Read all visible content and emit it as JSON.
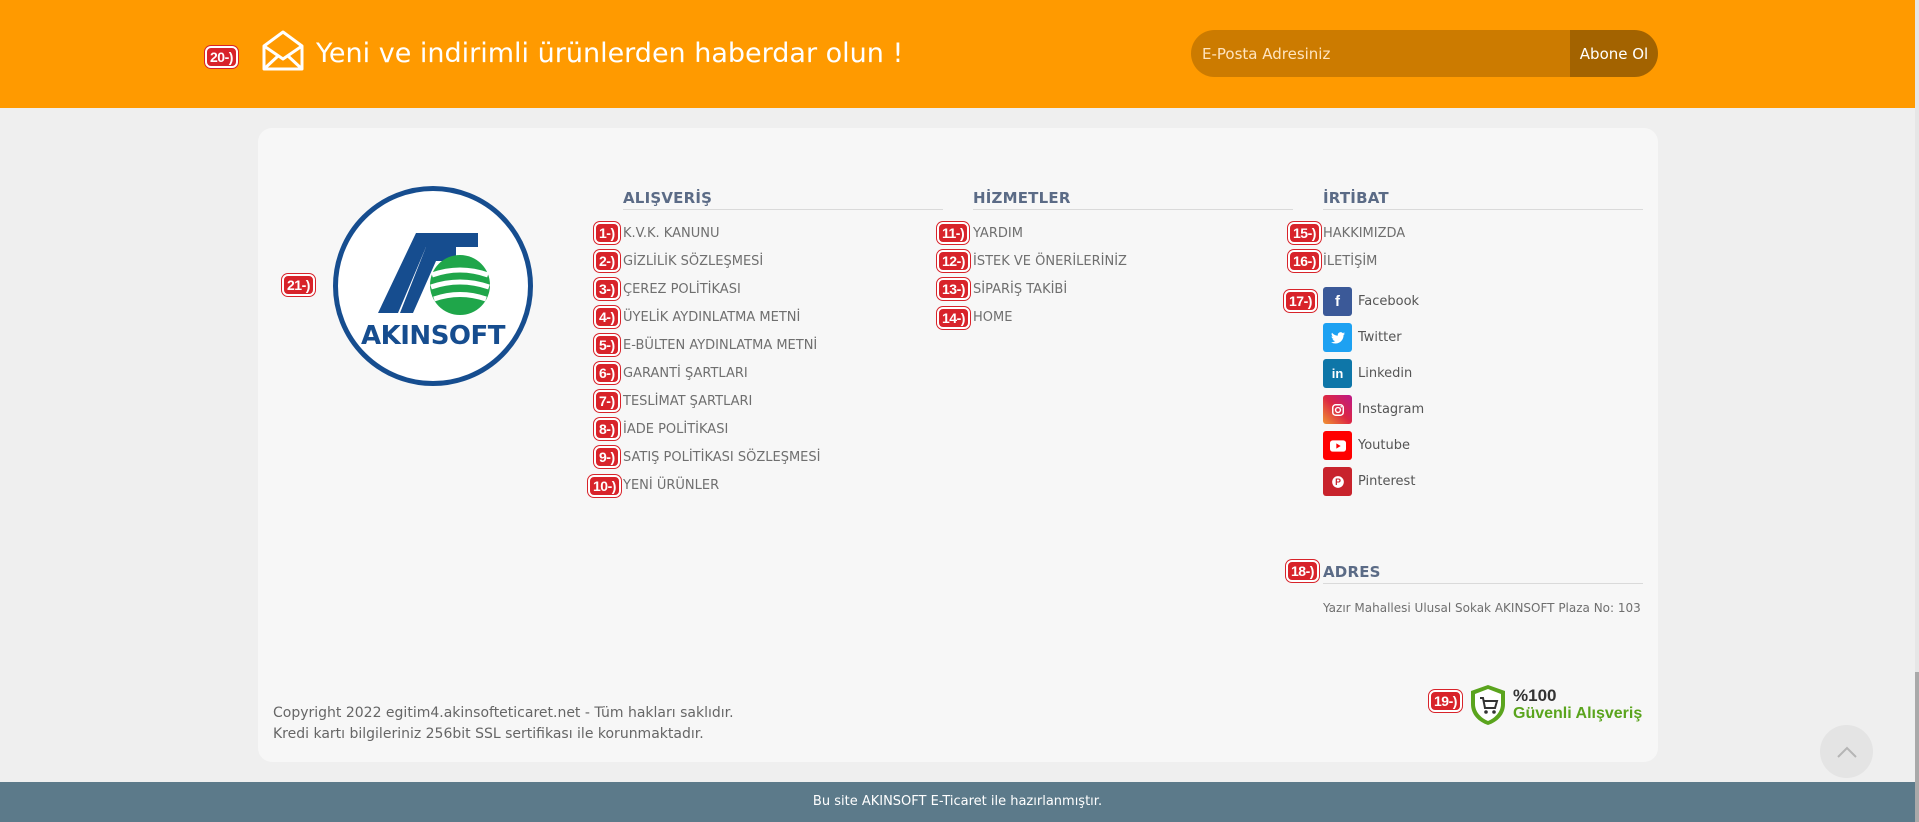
{
  "newsletter": {
    "badge": "20-)",
    "text": "Yeni ve indirimli ürünlerden haberdar olun !",
    "placeholder": "E-Posta Adresiniz",
    "button": "Abone Ol",
    "icon": "envelope-icon"
  },
  "logo": {
    "badge": "21-)",
    "word": "AKINSOFT"
  },
  "columns": {
    "alisveris": {
      "title": "ALIŞVERİŞ",
      "items": [
        {
          "badge": "1-)",
          "label": "K.V.K. KANUNU"
        },
        {
          "badge": "2-)",
          "label": "GİZLİLİK SÖZLEŞMESİ"
        },
        {
          "badge": "3-)",
          "label": "ÇEREZ POLİTİKASI"
        },
        {
          "badge": "4-)",
          "label": "ÜYELİK AYDINLATMA METNİ"
        },
        {
          "badge": "5-)",
          "label": "E-BÜLTEN AYDINLATMA METNİ"
        },
        {
          "badge": "6-)",
          "label": "GARANTİ ŞARTLARI"
        },
        {
          "badge": "7-)",
          "label": "TESLİMAT ŞARTLARI"
        },
        {
          "badge": "8-)",
          "label": "İADE POLİTİKASI"
        },
        {
          "badge": "9-)",
          "label": "SATIŞ POLİTİKASI SÖZLEŞMESİ"
        },
        {
          "badge": "10-)",
          "label": "YENİ ÜRÜNLER"
        }
      ]
    },
    "hizmetler": {
      "title": "HİZMETLER",
      "items": [
        {
          "badge": "11-)",
          "label": "YARDIM"
        },
        {
          "badge": "12-)",
          "label": "İSTEK VE ÖNERİLERİNİZ"
        },
        {
          "badge": "13-)",
          "label": "SİPARİŞ TAKİBİ"
        },
        {
          "badge": "14-)",
          "label": "HOME"
        }
      ]
    },
    "irtibat": {
      "title": "İRTİBAT",
      "items": [
        {
          "badge": "15-)",
          "label": "HAKKIMIZDA"
        },
        {
          "badge": "16-)",
          "label": "İLETİŞİM"
        }
      ],
      "social_badge": "17-)",
      "social": [
        {
          "label": "Facebook",
          "icon": "facebook-icon",
          "glyph": "f",
          "color": "#3b5998"
        },
        {
          "label": "Twitter",
          "icon": "twitter-icon",
          "glyph": "🐦",
          "color": "#1da1f2"
        },
        {
          "label": "Linkedin",
          "icon": "linkedin-icon",
          "glyph": "in",
          "color": "#0e76a8"
        },
        {
          "label": "Instagram",
          "icon": "instagram-icon",
          "glyph": "◎",
          "color": "#d6246e"
        },
        {
          "label": "Youtube",
          "icon": "youtube-icon",
          "glyph": "▶",
          "color": "#ff0000"
        },
        {
          "label": "Pinterest",
          "icon": "pinterest-icon",
          "glyph": "P",
          "color": "#c8232c"
        }
      ]
    },
    "adres": {
      "badge": "18-)",
      "title": "ADRES",
      "text": "Yazır Mahallesi Ulusal Sokak AKINSOFT Plaza No: 103"
    }
  },
  "copyright": {
    "line1": "Copyright 2022 egitim4.akinsofteticaret.net - Tüm hakları saklıdır.",
    "line2": "Kredi kartı bilgileriniz 256bit SSL sertifikası ile korunmaktadır."
  },
  "secure": {
    "badge": "19-)",
    "top": "%100",
    "bottom": "Güvenli Alışveriş",
    "icon": "cart-shield-icon"
  },
  "footer_bar": {
    "text": "Bu site AKINSOFT E-Ticaret ile hazırlanmıştır."
  },
  "colors": {
    "accent": "#ff9a00",
    "badge": "#d8232a",
    "footer_bar": "#5c7a8a",
    "brand": "#164d8f"
  }
}
